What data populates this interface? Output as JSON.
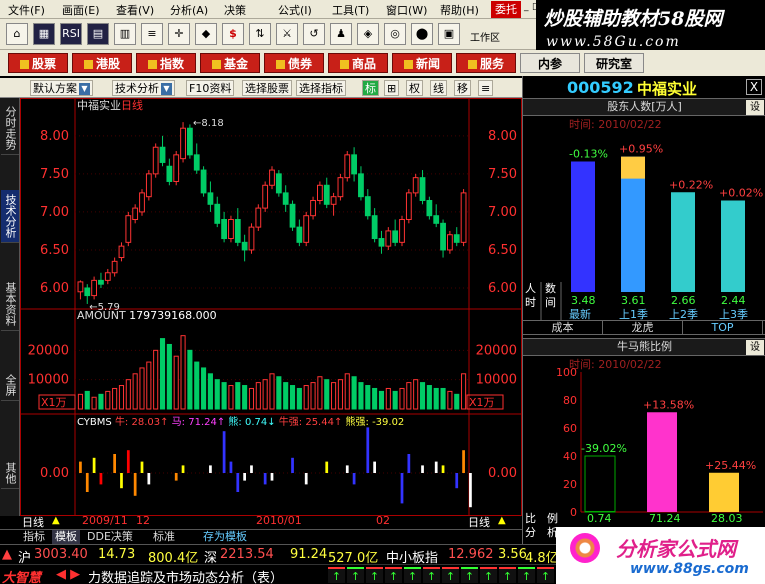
{
  "menu": {
    "items": [
      "文件(F)",
      "画面(E)",
      "查看(V)",
      "分析(A)",
      "决策",
      "公式(I)",
      "工具(T)",
      "窗口(W)",
      "帮助(H)"
    ],
    "trade": "委托",
    "controls": [
      "_",
      "□",
      "X"
    ]
  },
  "brand_top": {
    "line1": "炒股辅助教材58股网",
    "line2": "www.58Gu.com"
  },
  "toolbar": {
    "buttons": [
      "⌂",
      "▦",
      "RSI",
      "▤",
      "▥",
      "≡",
      "✛",
      "◆",
      "$",
      "⇅",
      "⚔",
      "↺",
      "♟",
      "◈",
      "◎",
      "⬤",
      "▣"
    ],
    "work_area": "工作区"
  },
  "categories": [
    "股票",
    "港股",
    "指数",
    "基金",
    "债券",
    "商品",
    "新闻",
    "服务",
    "内参",
    "研究室"
  ],
  "chart_toolbar": {
    "items": [
      "默认方案",
      "技术分析",
      "F10资料",
      "选择股票",
      "选择指标",
      "标",
      "⊞",
      "权",
      "线",
      "移",
      "≡"
    ]
  },
  "left_tabs": [
    "分时走势",
    "技术分析",
    "基本资料",
    "全屏",
    "其他"
  ],
  "chart": {
    "stock_label": "中福实业",
    "period_label": "日线",
    "high_annot": "8.18",
    "low_annot": "5.79",
    "amount_label": "AMOUNT",
    "amount_value": "179739168.000",
    "amount_ticks": [
      "20000",
      "10000"
    ],
    "x1_label": "X1万",
    "indicator": [
      {
        "name": "CYBMS",
        "color": "#ffffff"
      },
      {
        "name": "牛: 28.03↑",
        "color": "#ff4040"
      },
      {
        "name": "马: 71.24↑",
        "color": "#ff40ff"
      },
      {
        "name": "熊: 0.74↓",
        "color": "#40ffff"
      },
      {
        "name": "牛强: 25.44↑",
        "color": "#ff4040"
      },
      {
        "name": "熊强: -39.02",
        "color": "#ffff40"
      }
    ],
    "ind_tick": "0.00",
    "bottom": {
      "period": "日线",
      "dates": [
        "2009/11",
        "12",
        "2010/01",
        "02"
      ]
    }
  },
  "chart_data": {
    "type": "candlestick",
    "ylim": [
      5.75,
      8.3
    ],
    "y_ticks": [
      8.0,
      7.5,
      7.0,
      6.5,
      6.0
    ],
    "bars": [
      [
        5.95,
        6.1,
        5.85,
        6.08
      ],
      [
        6.0,
        6.05,
        5.79,
        5.9
      ],
      [
        5.9,
        6.15,
        5.85,
        6.1
      ],
      [
        6.1,
        6.2,
        6.0,
        6.05
      ],
      [
        6.1,
        6.25,
        6.05,
        6.2
      ],
      [
        6.2,
        6.4,
        6.15,
        6.35
      ],
      [
        6.4,
        6.6,
        6.35,
        6.55
      ],
      [
        6.6,
        7.0,
        6.55,
        6.95
      ],
      [
        6.9,
        7.1,
        6.85,
        7.05
      ],
      [
        7.0,
        7.3,
        6.95,
        7.25
      ],
      [
        7.2,
        7.55,
        7.15,
        7.5
      ],
      [
        7.5,
        7.9,
        7.45,
        7.85
      ],
      [
        7.85,
        8.0,
        7.6,
        7.65
      ],
      [
        7.6,
        7.7,
        7.35,
        7.4
      ],
      [
        7.4,
        7.8,
        7.35,
        7.75
      ],
      [
        7.7,
        8.18,
        7.65,
        8.1
      ],
      [
        8.1,
        8.15,
        7.7,
        7.75
      ],
      [
        7.75,
        7.9,
        7.5,
        7.55
      ],
      [
        7.55,
        7.6,
        7.2,
        7.25
      ],
      [
        7.25,
        7.4,
        7.0,
        7.1
      ],
      [
        7.1,
        7.2,
        6.8,
        6.85
      ],
      [
        6.9,
        7.0,
        6.6,
        6.65
      ],
      [
        6.65,
        6.95,
        6.6,
        6.9
      ],
      [
        6.9,
        7.05,
        6.55,
        6.6
      ],
      [
        6.6,
        6.7,
        6.35,
        6.5
      ],
      [
        6.5,
        6.85,
        6.45,
        6.8
      ],
      [
        6.8,
        7.1,
        6.75,
        7.05
      ],
      [
        7.05,
        7.4,
        7.0,
        7.35
      ],
      [
        7.35,
        7.6,
        7.3,
        7.55
      ],
      [
        7.5,
        7.55,
        7.2,
        7.25
      ],
      [
        7.25,
        7.35,
        7.0,
        7.1
      ],
      [
        7.1,
        7.15,
        6.75,
        6.8
      ],
      [
        6.8,
        6.9,
        6.55,
        6.6
      ],
      [
        6.6,
        7.0,
        6.55,
        6.95
      ],
      [
        6.95,
        7.2,
        6.9,
        7.15
      ],
      [
        7.15,
        7.4,
        7.1,
        7.35
      ],
      [
        7.35,
        7.45,
        7.05,
        7.1
      ],
      [
        7.1,
        7.25,
        6.95,
        7.2
      ],
      [
        7.2,
        7.5,
        7.15,
        7.45
      ],
      [
        7.45,
        7.8,
        7.4,
        7.75
      ],
      [
        7.75,
        7.85,
        7.4,
        7.5
      ],
      [
        7.5,
        7.6,
        7.15,
        7.2
      ],
      [
        7.2,
        7.3,
        6.9,
        6.95
      ],
      [
        6.95,
        7.05,
        6.6,
        6.65
      ],
      [
        6.65,
        6.75,
        6.45,
        6.55
      ],
      [
        6.55,
        6.8,
        6.5,
        6.75
      ],
      [
        6.75,
        6.9,
        6.55,
        6.6
      ],
      [
        6.6,
        6.95,
        6.55,
        6.9
      ],
      [
        6.9,
        7.3,
        6.85,
        7.25
      ],
      [
        7.25,
        7.5,
        7.2,
        7.45
      ],
      [
        7.45,
        7.55,
        7.1,
        7.15
      ],
      [
        7.15,
        7.2,
        6.9,
        6.95
      ],
      [
        6.95,
        7.1,
        6.8,
        6.85
      ],
      [
        6.85,
        6.9,
        6.4,
        6.5
      ],
      [
        6.5,
        6.75,
        6.45,
        6.7
      ],
      [
        6.7,
        6.8,
        6.55,
        6.6
      ],
      [
        6.6,
        7.3,
        6.55,
        7.25
      ]
    ],
    "volume": [
      5,
      6,
      4,
      5,
      6,
      7,
      8,
      10,
      12,
      14,
      16,
      20,
      24,
      22,
      18,
      25,
      20,
      16,
      14,
      12,
      10,
      9,
      8,
      9,
      8,
      7,
      9,
      10,
      12,
      11,
      9,
      8,
      7,
      8,
      9,
      11,
      10,
      9,
      10,
      12,
      11,
      9,
      8,
      7,
      6,
      7,
      6,
      7,
      9,
      10,
      9,
      8,
      7,
      7,
      6,
      5,
      12
    ],
    "indicator_bars": [
      [
        0,
        0.3,
        "#ff8800"
      ],
      [
        1,
        -0.5,
        "#ff8800"
      ],
      [
        2,
        0.4,
        "#ffff00"
      ],
      [
        3,
        -0.3,
        "#ff0000"
      ],
      [
        5,
        0.5,
        "#ff8800"
      ],
      [
        6,
        -0.4,
        "#ffff00"
      ],
      [
        7,
        0.6,
        "#ff0000"
      ],
      [
        8,
        -0.6,
        "#ff8800"
      ],
      [
        9,
        0.3,
        "#ffff00"
      ],
      [
        10,
        -0.3,
        "#ffffff"
      ],
      [
        14,
        -0.2,
        "#ff8800"
      ],
      [
        15,
        0.2,
        "#ffff00"
      ],
      [
        19,
        0.2,
        "#ffffff"
      ],
      [
        21,
        1.1,
        "#3333ff"
      ],
      [
        22,
        0.3,
        "#3333ff"
      ],
      [
        23,
        -0.5,
        "#3333ff"
      ],
      [
        24,
        -0.2,
        "#ffffff"
      ],
      [
        25,
        0.2,
        "#ffffff"
      ],
      [
        27,
        -0.3,
        "#3333ff"
      ],
      [
        28,
        -0.2,
        "#ffffff"
      ],
      [
        31,
        0.4,
        "#3333ff"
      ],
      [
        33,
        -0.3,
        "#ffffff"
      ],
      [
        36,
        0.3,
        "#ffff00"
      ],
      [
        39,
        0.2,
        "#ffffff"
      ],
      [
        40,
        -0.3,
        "#3333ff"
      ],
      [
        42,
        1.2,
        "#3333ff"
      ],
      [
        43,
        0.3,
        "#ffffff"
      ],
      [
        47,
        -0.8,
        "#3333ff"
      ],
      [
        48,
        0.5,
        "#3333ff"
      ],
      [
        50,
        0.2,
        "#ffffff"
      ],
      [
        52,
        0.3,
        "#ffffff"
      ],
      [
        53,
        0.2,
        "#ffff00"
      ],
      [
        55,
        -0.4,
        "#3333ff"
      ],
      [
        56,
        0.6,
        "#ff8800"
      ],
      [
        57,
        -0.9,
        "#ffffff"
      ]
    ]
  },
  "right_panel": {
    "code": "000592",
    "name": "中福实业",
    "close": "X",
    "shareholder": {
      "title": "股东人数[万人]",
      "set": "设",
      "time": "时间: 2010/02/22",
      "side": [
        "人",
        "时",
        "数",
        "间"
      ],
      "bars": [
        {
          "value": 3.48,
          "change": "-0.13%",
          "label": "最新",
          "color": "#3333ff"
        },
        {
          "value": 3.61,
          "change": "+0.95%",
          "label": "上1季",
          "color": "#3399ff"
        },
        {
          "value": 2.66,
          "change": "+0.22%",
          "label": "上2季",
          "color": "#33cccc"
        },
        {
          "value": 2.44,
          "change": "+0.02%",
          "label": "上3季",
          "color": "#33cccc"
        }
      ]
    },
    "tabs": [
      "成本",
      "龙虎",
      "TOP"
    ],
    "bullbear": {
      "title": "牛马熊比例",
      "set": "设",
      "time": "时间: 2010/02/22",
      "ticks": [
        "100",
        "80",
        "60",
        "40",
        "20",
        "0"
      ],
      "side": [
        "比",
        "例",
        "分",
        "析"
      ],
      "bars": [
        {
          "value": 0.74,
          "change": "-39.02%",
          "color": "#00aa00"
        },
        {
          "value": 71.24,
          "change": "+13.58%",
          "color": "#ff33cc"
        },
        {
          "value": 28.03,
          "change": "+25.44%",
          "color": "#ffcc33"
        }
      ]
    }
  },
  "bottom_tabs": [
    "指标",
    "模板",
    "DDE决策",
    "标准",
    "存为模板"
  ],
  "status": {
    "sh": "沪",
    "sh_val": "3003.40",
    "sh_chg": "14.73",
    "sh_amt": "800.4亿",
    "sz": "深",
    "sz_val": "2213.54",
    "sz_chg": "91.24",
    "sz_amt": "527.0亿",
    "sme": "中小板指",
    "sme_val": "12.962",
    "sme_chg": "3.56",
    "sme_amt": "4.8亿"
  },
  "ticker": {
    "app": "大智慧",
    "text": "力数据追踪及市场动态分析（表）"
  },
  "brand_bot": {
    "title": "分析家公式网",
    "url": "www.88gs.com"
  },
  "colors": {
    "up": "#ff3333",
    "down": "#00cc66",
    "accent": "#33ccff"
  }
}
